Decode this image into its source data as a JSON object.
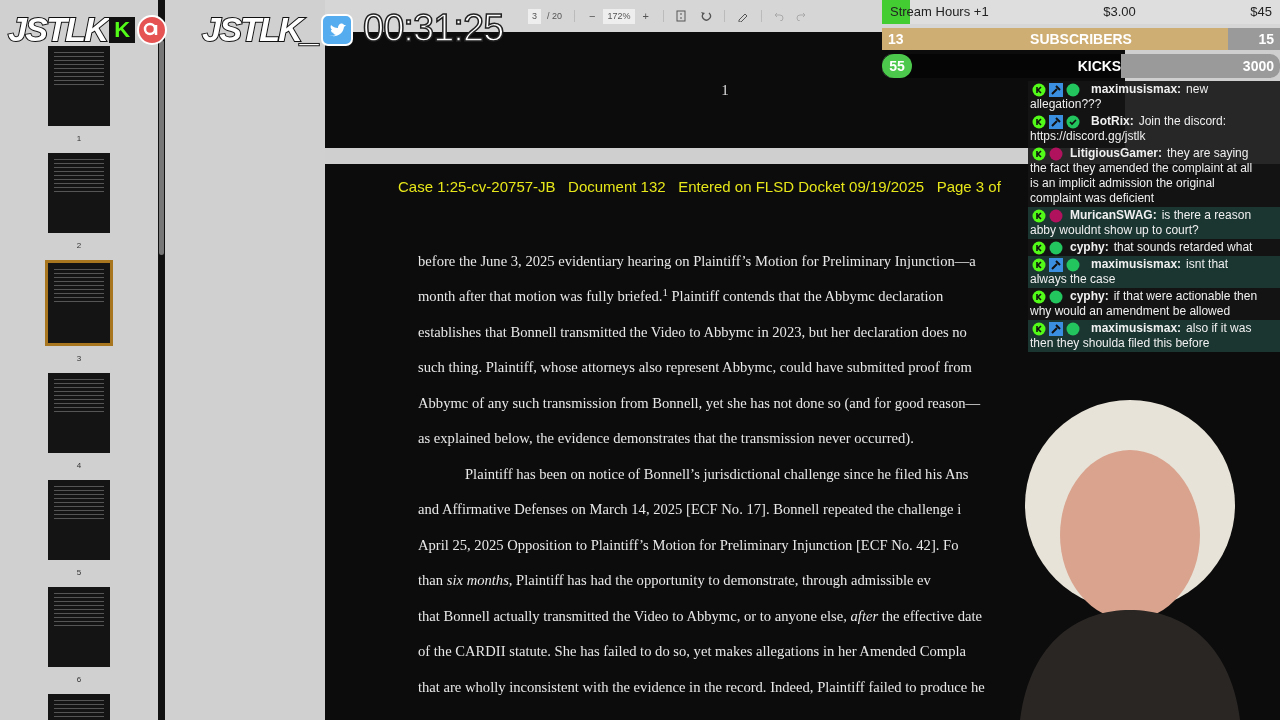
{
  "logos": [
    {
      "text": "JSTLK",
      "badge": "K",
      "kind": "kick"
    },
    {
      "text": "JSTLK_",
      "kind": "twitter"
    }
  ],
  "timer": "00:31:25",
  "toolbar": {
    "page": "3",
    "page_total": "/ 20",
    "zoom_out": "−",
    "zoom": "172%",
    "zoom_in": "+"
  },
  "thumbnails": [
    {
      "label": "1",
      "selected": false
    },
    {
      "label": "2",
      "selected": false
    },
    {
      "label": "3",
      "selected": true
    },
    {
      "label": "4",
      "selected": false
    },
    {
      "label": "5",
      "selected": false
    },
    {
      "label": "6",
      "selected": false
    },
    {
      "selected": false
    }
  ],
  "previous_page": {
    "page_number": "1"
  },
  "document": {
    "header": "Case 1:25-cv-20757-JB   Document 132   Entered on FLSD Docket 09/19/2025   Page 3 of",
    "lines": [
      {
        "text": "before the June 3, 2025 evidentiary hearing on Plaintiff’s Motion for Preliminary Injunction—a",
        "kind": "line"
      },
      {
        "text": "month after that motion was fully briefed.$^{1}$ Plaintiff contends that the Abbymc declaration",
        "kind": "line"
      },
      {
        "text": "establishes that Bonnell transmitted the Video to Abbymc in 2023, but her declaration does no",
        "kind": "line"
      },
      {
        "text": "such thing. Plaintiff, whose attorneys also represent Abbymc, could have submitted proof from",
        "kind": "line"
      },
      {
        "text": "Abbymc of any such transmission from Bonnell, yet she has not done so (and for good reason—",
        "kind": "line"
      },
      {
        "text": "as explained below, the evidence demonstrates that the transmission never occurred).",
        "kind": "line"
      },
      {
        "text": "Plaintiff has been on notice of Bonnell’s jurisdictional challenge since he filed his Ans",
        "kind": "indented"
      },
      {
        "text": "and Affirmative Defenses on March 14, 2025 [ECF No. 17]. Bonnell repeated the challenge i",
        "kind": "line"
      },
      {
        "text": "April 25, 2025 Opposition to Plaintiff’s Motion for Preliminary Injunction [ECF No. 42]. Fo",
        "kind": "line"
      },
      {
        "text": "than *six months*, Plaintiff has had the opportunity to demonstrate, through admissible ev",
        "kind": "line"
      },
      {
        "text": "that Bonnell actually transmitted the Video to Abbymc, or to anyone else, *after* the effective date",
        "kind": "line"
      },
      {
        "text": "of the CARDII statute. She has failed to do so, yet makes allegations in her Amended Compla",
        "kind": "line"
      },
      {
        "text": "that are wholly inconsistent with the evidence in the record. Indeed, Plaintiff failed to produce he",
        "kind": "line"
      }
    ]
  },
  "goals": {
    "stream_hours": {
      "label": "Stream Hours +1",
      "amount": "$3.00",
      "target": "$45",
      "level": 0.07
    },
    "subscribers": {
      "current": "13",
      "label": "SUBSCRIBERS",
      "target": "15",
      "level": 0.87
    },
    "kicks": {
      "current": "55",
      "label": "KICKS",
      "target": "3000",
      "level": 0.6
    }
  },
  "chat": [
    {
      "user": "maximusismax:",
      "lines": [
        "new",
        "allegation???"
      ],
      "moderator": true,
      "verified": false,
      "color": "#22c55e"
    },
    {
      "user": "BotRix:",
      "lines": [
        "Join the discord:",
        "https://discord.gg/jstlk"
      ],
      "moderator": true,
      "verified": true,
      "color": "#22c55e"
    },
    {
      "user": "LitigiousGamer:",
      "lines": [
        "they are saying",
        "the fact they amended the complaint at all",
        "is an implicit admission the original",
        "complaint was deficient"
      ],
      "moderator": false,
      "verified": false,
      "color": "#b0125e"
    },
    {
      "user": "MuricanSWAG:",
      "lines": [
        "is there a reason",
        "abby wouldnt show up to court?"
      ],
      "moderator": false,
      "verified": false,
      "color": "#b0125e"
    },
    {
      "user": "cyphy:",
      "lines": [
        "that sounds retarded what"
      ],
      "moderator": false,
      "verified": false,
      "color": "#22c55e"
    },
    {
      "user": "maximusismax:",
      "lines": [
        "isnt that",
        "always the case"
      ],
      "moderator": true,
      "verified": false,
      "color": "#22c55e"
    },
    {
      "user": "cyphy:",
      "lines": [
        "if that were actionable then",
        "why would an amendment be allowed"
      ],
      "moderator": false,
      "verified": false,
      "color": "#22c55e"
    },
    {
      "user": "maximusismax:",
      "lines": [
        "also if it was",
        "then they shoulda filed this before"
      ],
      "moderator": true,
      "verified": false,
      "color": "#22c55e"
    }
  ]
}
